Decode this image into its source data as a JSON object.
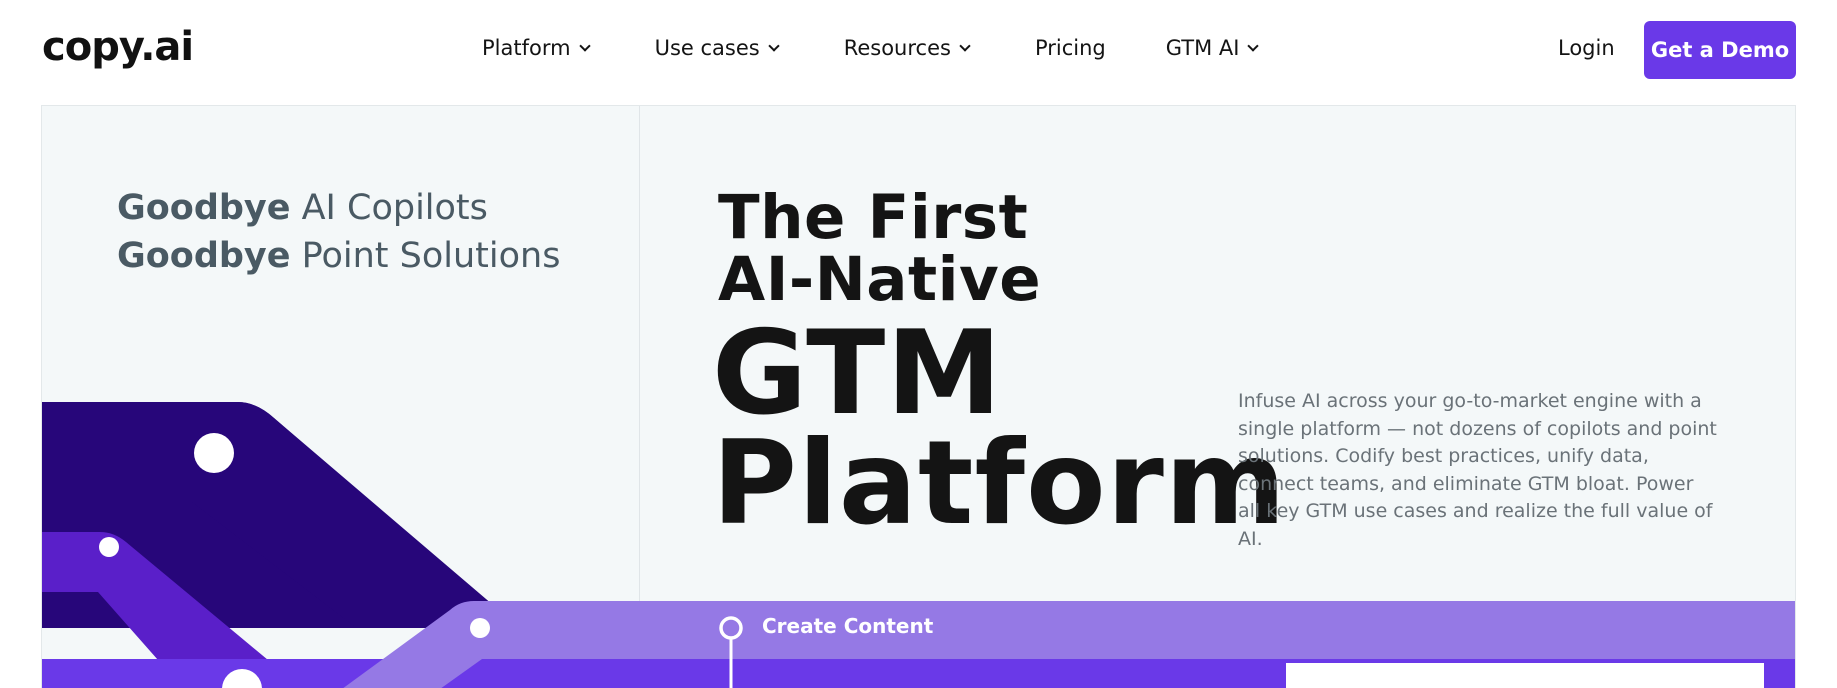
{
  "header": {
    "logo": "copy.ai",
    "nav": [
      {
        "label": "Platform",
        "has_dropdown": true
      },
      {
        "label": "Use cases",
        "has_dropdown": true
      },
      {
        "label": "Resources",
        "has_dropdown": true
      },
      {
        "label": "Pricing",
        "has_dropdown": false
      },
      {
        "label": "GTM AI",
        "has_dropdown": true
      }
    ],
    "login_label": "Login",
    "demo_label": "Get a Demo"
  },
  "hero": {
    "goodbye": [
      {
        "bold": "Goodbye",
        "rest": " AI Copilots"
      },
      {
        "bold": "Goodbye",
        "rest": " Point Solutions"
      }
    ],
    "title_lines": [
      "The First",
      "AI-Native",
      "GTM",
      "Platform"
    ],
    "description": "Infuse AI across your go-to-market engine with a single platform — not dozens of copilots and point solutions. Codify best practices, unify data, connect teams, and eliminate GTM bloat. Power all key GTM use cases and realize the full value of AI.",
    "band_label": "Create Content"
  },
  "colors": {
    "accent": "#6a39e8",
    "deep_purple": "#27067a",
    "mid_purple": "#5a1fc9",
    "light_purple": "#9579e5",
    "hero_bg": "#f4f8f9"
  }
}
